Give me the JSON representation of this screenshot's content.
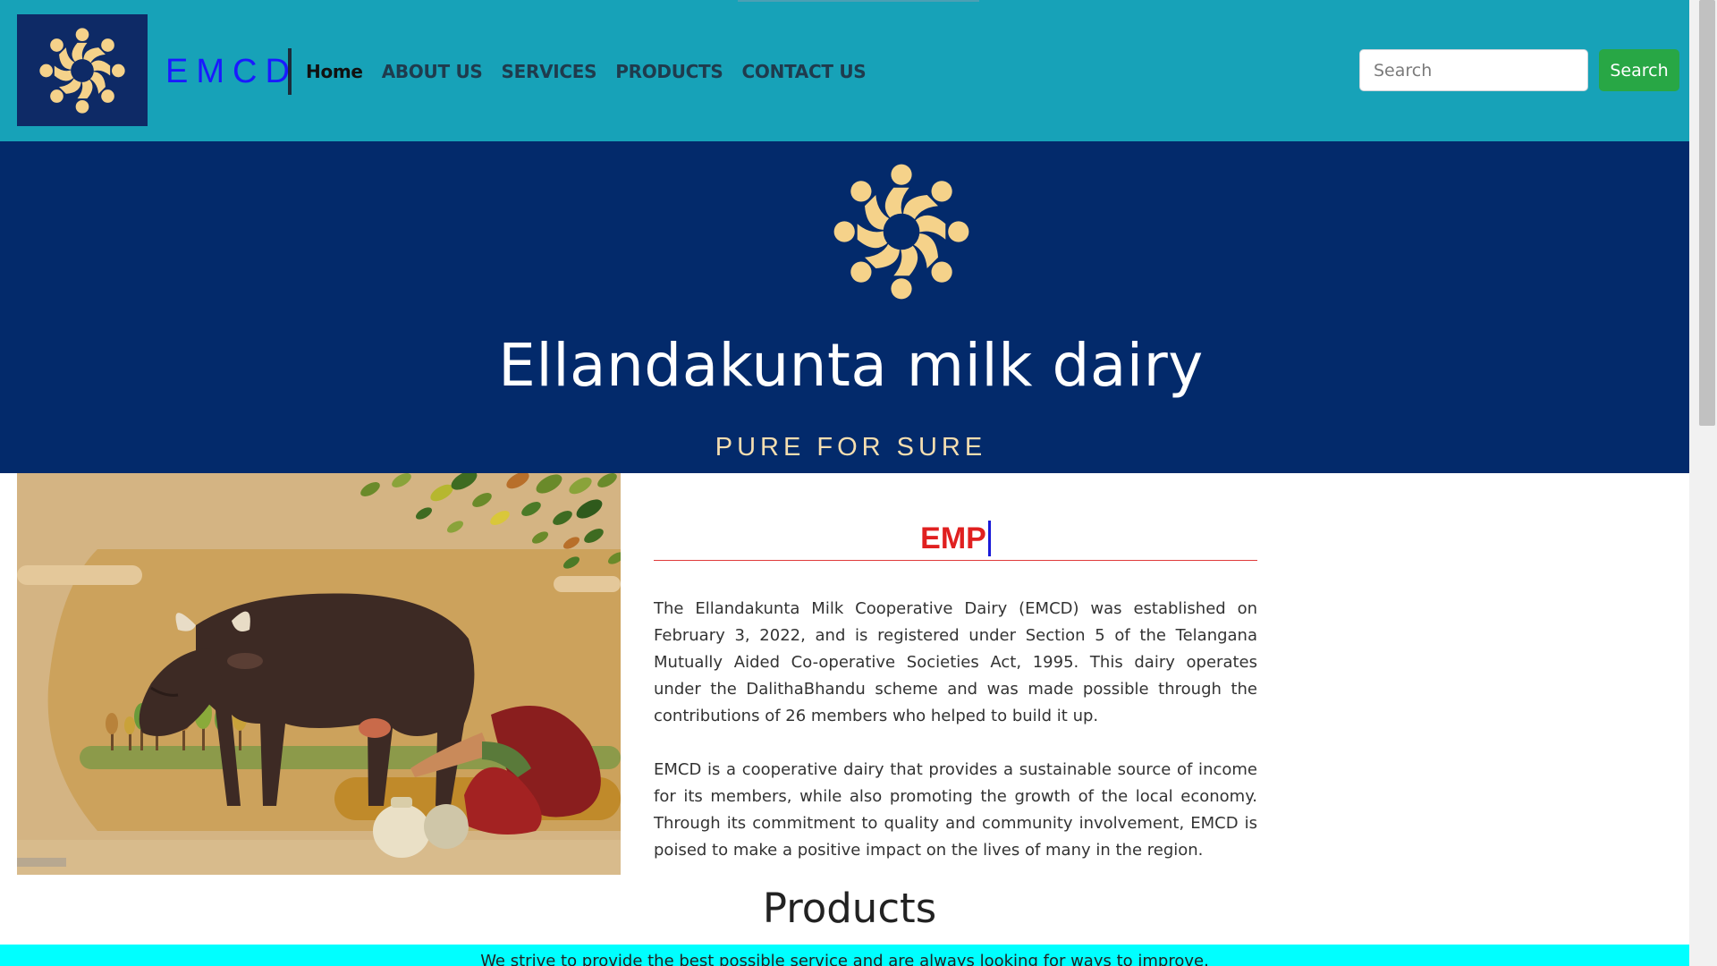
{
  "navbar": {
    "brand": "EMCD",
    "links": [
      "Home",
      "ABOUT US",
      "SERVICES",
      "PRODUCTS",
      "CONTACT US"
    ],
    "search": {
      "placeholder": "Search",
      "button_label": "Search"
    }
  },
  "hero": {
    "title": "Ellandakunta milk dairy",
    "tagline": "PURE FOR SURE"
  },
  "main": {
    "section_heading": "EMP",
    "paragraphs": [
      "The Ellandakunta Milk Cooperative Dairy (EMCD) was established on February 3, 2022, and is registered under Section 5 of the Telangana Mutually Aided Co-operative Societies Act, 1995. This dairy operates under the DalithaBhandu scheme and was made possible through the contributions of 26 members who helped to build it up.",
      "EMCD is a cooperative dairy that provides a sustainable source of income for its members, while also promoting the growth of the local economy. Through its commitment to quality and community involvement, EMCD is poised to make a positive impact on the lives of many in the region."
    ],
    "products_heading": "Products"
  },
  "footer": {
    "strip_text": "We strive to provide the best possible service and are always looking for ways to improve."
  },
  "colors": {
    "navbar_bg": "#17a2b8",
    "hero_bg": "#032a6b",
    "logo_gold": "#f5d28a",
    "brand_text": "#1a1aff",
    "heading_red": "#e02020",
    "search_button": "#28a745",
    "footer_strip": "#00ffff"
  },
  "icons": {
    "logo": "community-circle-logo",
    "illustration": "buffalo-milking-illustration"
  }
}
